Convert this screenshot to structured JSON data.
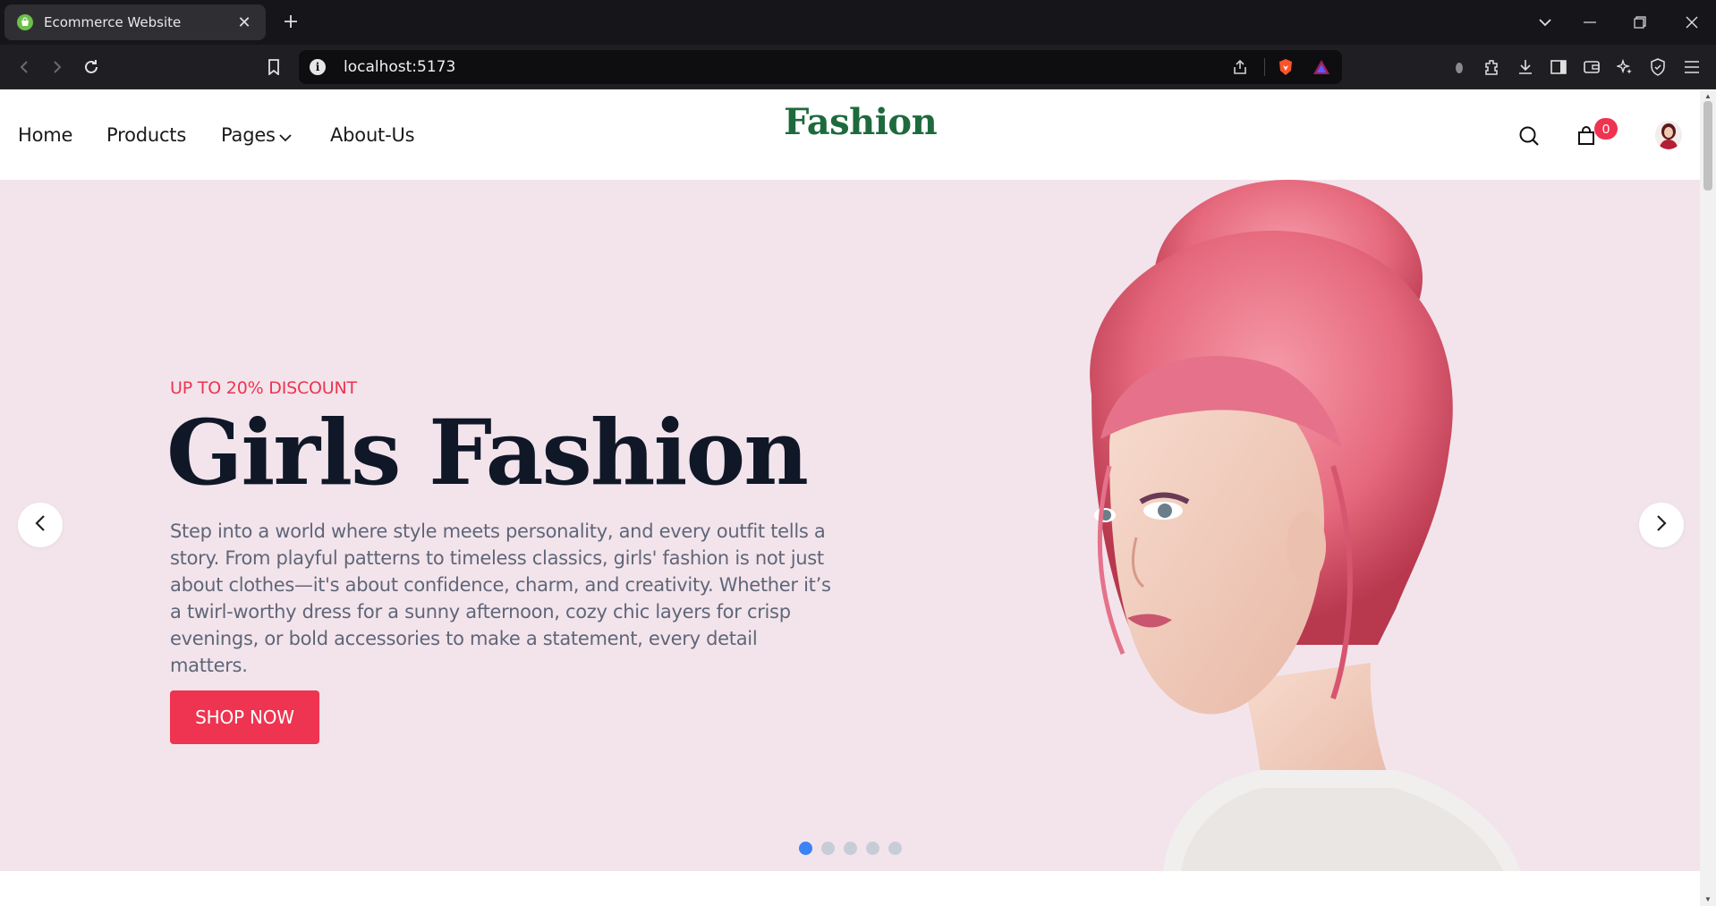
{
  "browser": {
    "tab_title": "Ecommerce Website",
    "url": "localhost:5173"
  },
  "nav": {
    "links": [
      "Home",
      "Products",
      "Pages",
      "About-Us"
    ],
    "logo": "Fashion",
    "cart_count": "0"
  },
  "hero": {
    "badge": "UP TO 20% DISCOUNT",
    "title": "Girls Fashion",
    "description": "Step into a world where style meets personality, and every outfit tells a story. From playful patterns to timeless classics, girls' fashion is not just about clothes—it's about confidence, charm, and creativity. Whether it’s a twirl-worthy dress for a sunny afternoon, cozy chic layers for crisp evenings, or bold accessories to make a statement, every detail matters.",
    "cta": "SHOP NOW",
    "slides_total": 5,
    "active_slide": 1
  },
  "colors": {
    "accent": "#ee3450",
    "logo": "#1e6a3c",
    "hero_bg": "#f3e4ec",
    "dot_active": "#3b82f6"
  },
  "icons": [
    "app-favicon-icon",
    "close-icon",
    "plus-icon",
    "chevron-down-icon",
    "minimize-icon",
    "restore-icon",
    "back-icon",
    "forward-icon",
    "reload-icon",
    "bookmark-icon",
    "info-icon",
    "share-icon",
    "brave-shield-icon",
    "brave-rewards-icon",
    "extensions-icon",
    "download-icon",
    "sidebar-icon",
    "wallet-icon",
    "leo-icon",
    "vpn-icon",
    "menu-icon",
    "search-icon",
    "shopping-bag-icon",
    "chevron-left-icon",
    "chevron-right-icon"
  ]
}
